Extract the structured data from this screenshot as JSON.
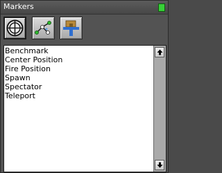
{
  "window": {
    "title": "Markers",
    "close_color": "#38d038"
  },
  "toolbar": {
    "tools": [
      {
        "icon": "crosshair-icon",
        "selected": true
      },
      {
        "icon": "node-path-icon",
        "selected": false
      },
      {
        "icon": "clip-tool-icon",
        "selected": false
      }
    ]
  },
  "markers": {
    "items": [
      "Benchmark",
      "Center Position",
      "Fire Position",
      "Spawn",
      "Spectator",
      "Teleport"
    ]
  },
  "scrollbar": {
    "up_icon": "arrow-up-icon",
    "down_icon": "arrow-down-icon"
  }
}
